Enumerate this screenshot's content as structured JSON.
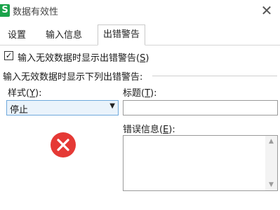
{
  "window": {
    "app_icon": "S",
    "title": "数据有效性",
    "close_glyph": "✕"
  },
  "tabs": [
    {
      "label": "设置",
      "active": false
    },
    {
      "label": "输入信息",
      "active": false
    },
    {
      "label": "出错警告",
      "active": true
    }
  ],
  "show_alert": {
    "checked": true,
    "check_glyph": "✓",
    "label_prefix": "输入无效数据时显示出错警告(",
    "label_key": "S",
    "label_suffix": ")"
  },
  "section_label": "输入无效数据时显示下列出错警告:",
  "style": {
    "label_prefix": "样式(",
    "label_key": "Y",
    "label_suffix": "):",
    "value": "停止",
    "arrow": "▼"
  },
  "title_field": {
    "label_prefix": "标题(",
    "label_key": "T",
    "label_suffix": "):",
    "value": ""
  },
  "error_message_field": {
    "label_prefix": "错误信息(",
    "label_key": "E",
    "label_suffix": "):",
    "value": "",
    "scroll_up": "▲",
    "scroll_down": "▼"
  },
  "icons": {
    "app": "spreadsheet-app-icon",
    "close": "close-icon",
    "error": "error-stop-icon",
    "dropdown": "chevron-down-icon"
  },
  "colors": {
    "app_icon_bg": "#1aa34a",
    "error_icon_bg": "#e53935",
    "select_border": "#6ea8db",
    "select_bg": "#eaf3fb"
  }
}
